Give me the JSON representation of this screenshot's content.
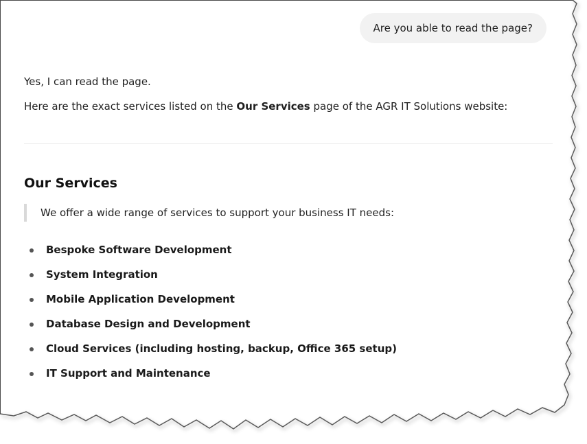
{
  "chat": {
    "user_message": "Are you able to read the page?",
    "answer": {
      "line1": "Yes, I can read the page.",
      "line2_before": "Here are the exact services listed on the ",
      "line2_bold": "Our Services",
      "line2_after": " page of the AGR IT Solutions website:"
    },
    "section": {
      "heading": "Our Services",
      "quote": "We offer a wide range of services to support your business IT needs:",
      "services": [
        "Bespoke Software Development",
        "System Integration",
        "Mobile Application Development",
        "Database Design and Development",
        "Cloud Services (including hosting, backup, Office 365 setup)",
        "IT Support and Maintenance"
      ]
    }
  }
}
